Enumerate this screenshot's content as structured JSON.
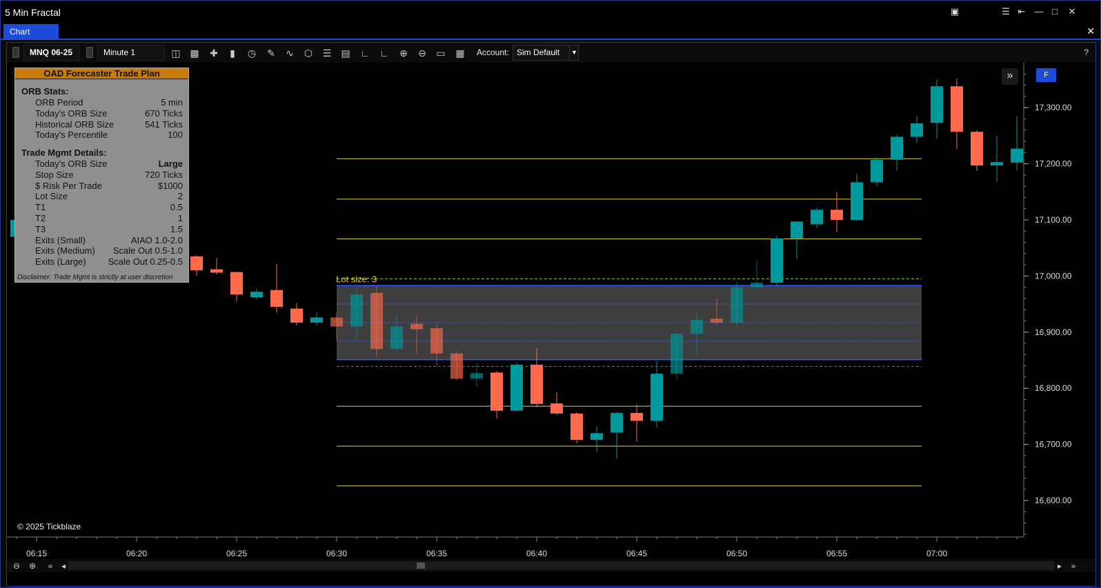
{
  "window": {
    "title": "5 Min Fractal"
  },
  "tabs": [
    {
      "label": "Chart",
      "active": true
    }
  ],
  "toolbar": {
    "instrument": "MNQ 06-25",
    "interval": "Minute 1",
    "account_label": "Account:",
    "account_value": "Sim Default",
    "help": "?",
    "tools": [
      "bar-type-icon",
      "chart-style-icon",
      "crosshair-icon",
      "candle-style-icon",
      "time-icon",
      "draw-icon",
      "indicator-icon",
      "object-icon",
      "list-icon",
      "data-box-icon",
      "axis-icon",
      "axis2-icon",
      "zoom-in-icon",
      "zoom-out-icon",
      "open-icon",
      "save-icon"
    ]
  },
  "panel": {
    "title": "OAD Forecaster Trade Plan",
    "orb_title": "ORB Stats:",
    "orb_rows": [
      {
        "k": "ORB Period",
        "v": "5 min"
      },
      {
        "k": "Today's ORB Size",
        "v": "670 Ticks"
      },
      {
        "k": "Historical ORB Size",
        "v": "541 Ticks"
      },
      {
        "k": "Today's Percentile",
        "v": "100"
      }
    ],
    "mgmt_title": "Trade Mgmt Details:",
    "mgmt_rows": [
      {
        "k": "Today's ORB Size",
        "v": "Large",
        "bold": true
      },
      {
        "k": "Stop Size",
        "v": "720 Ticks"
      },
      {
        "k": "$ Risk Per Trade",
        "v": "$1000"
      },
      {
        "k": "Lot Size",
        "v": "2"
      },
      {
        "k": "T1",
        "v": "0.5"
      },
      {
        "k": "T2",
        "v": "1"
      },
      {
        "k": "T3",
        "v": "1.5"
      },
      {
        "k": "Exits (Small)",
        "v": "AIAO 1.0-2.0"
      },
      {
        "k": "Exits (Medium)",
        "v": "Scale Out 0.5-1.0"
      },
      {
        "k": "Exits (Large)",
        "v": "Scale Out 0.25-0.5"
      }
    ],
    "disclaimer": "Disclaimer: Trade Mgmt is strictly at user discretion"
  },
  "copyright": "© 2025 Tickblaze",
  "f_button": "F",
  "chart_data": {
    "type": "candlestick",
    "price_axis_labels": [
      "17,300.00",
      "17,200.00",
      "17,100.00",
      "17,000.00",
      "16,900.00",
      "16,800.00",
      "16,700.00",
      "16,600.00"
    ],
    "price_axis_values": [
      17300,
      17200,
      17100,
      17000,
      16900,
      16800,
      16700,
      16600
    ],
    "time_axis_labels": [
      "06:15",
      "06:20",
      "06:25",
      "06:30",
      "06:35",
      "06:40",
      "06:45",
      "06:50",
      "06:55",
      "07:00"
    ],
    "ylim": [
      16535,
      17380
    ],
    "annotation": "Lot size: 3",
    "orb_high": 16983,
    "orb_low": 16851,
    "orb_mid_lines": [
      16950,
      16917,
      16884
    ],
    "entry_line": 16995,
    "stop_line": 16839,
    "target_lines_up": [
      17066,
      17137,
      17209
    ],
    "target_lines_down": [
      16768,
      16697,
      16626
    ],
    "colors": {
      "up": "#00999c",
      "down": "#ff6a4d",
      "target": "#e6d43a",
      "orb_fill": "#3e3e3e",
      "orb_edge": "#2a5cff"
    },
    "candles": [
      {
        "t": "06:14",
        "o": 17070,
        "h": 17090,
        "c": 17100,
        "l": 17060
      },
      {
        "t": "06:23",
        "o": 17035,
        "h": 17037,
        "c": 17010,
        "l": 17000
      },
      {
        "t": "06:24",
        "o": 17012,
        "h": 17032,
        "c": 17006,
        "l": 17003
      },
      {
        "t": "06:25",
        "o": 17007,
        "h": 17008,
        "c": 16967,
        "l": 16955
      },
      {
        "t": "06:26",
        "o": 16962,
        "h": 16977,
        "c": 16972,
        "l": 16958
      },
      {
        "t": "06:27",
        "o": 16975,
        "h": 17022,
        "c": 16945,
        "l": 16935
      },
      {
        "t": "06:28",
        "o": 16942,
        "h": 16952,
        "c": 16917,
        "l": 16912
      },
      {
        "t": "06:29",
        "o": 16917,
        "h": 16935,
        "c": 16926,
        "l": 16912
      },
      {
        "t": "06:30",
        "o": 16926,
        "h": 16935,
        "c": 16910,
        "l": 16885
      },
      {
        "t": "06:31",
        "o": 16910,
        "h": 16975,
        "c": 16967,
        "l": 16890
      },
      {
        "t": "06:32",
        "o": 16970,
        "h": 16982,
        "c": 16870,
        "l": 16855
      },
      {
        "t": "06:33",
        "o": 16870,
        "h": 16932,
        "c": 16910,
        "l": 16865
      },
      {
        "t": "06:34",
        "o": 16915,
        "h": 16930,
        "c": 16905,
        "l": 16862
      },
      {
        "t": "06:35",
        "o": 16907,
        "h": 16913,
        "c": 16862,
        "l": 16840
      },
      {
        "t": "06:36",
        "o": 16862,
        "h": 16866,
        "c": 16817,
        "l": 16814
      },
      {
        "t": "06:37",
        "o": 16817,
        "h": 16846,
        "c": 16827,
        "l": 16803
      },
      {
        "t": "06:38",
        "o": 16828,
        "h": 16831,
        "c": 16760,
        "l": 16746
      },
      {
        "t": "06:39",
        "o": 16760,
        "h": 16846,
        "c": 16842,
        "l": 16758
      },
      {
        "t": "06:40",
        "o": 16842,
        "h": 16872,
        "c": 16772,
        "l": 16766
      },
      {
        "t": "06:41",
        "o": 16773,
        "h": 16793,
        "c": 16755,
        "l": 16752
      },
      {
        "t": "06:42",
        "o": 16755,
        "h": 16757,
        "c": 16708,
        "l": 16702
      },
      {
        "t": "06:43",
        "o": 16708,
        "h": 16732,
        "c": 16720,
        "l": 16686
      },
      {
        "t": "06:44",
        "o": 16721,
        "h": 16758,
        "c": 16756,
        "l": 16674
      },
      {
        "t": "06:45",
        "o": 16756,
        "h": 16771,
        "c": 16742,
        "l": 16705
      },
      {
        "t": "06:46",
        "o": 16742,
        "h": 16848,
        "c": 16826,
        "l": 16730
      },
      {
        "t": "06:47",
        "o": 16826,
        "h": 16898,
        "c": 16897,
        "l": 16816
      },
      {
        "t": "06:48",
        "o": 16897,
        "h": 16935,
        "c": 16922,
        "l": 16855
      },
      {
        "t": "06:49",
        "o": 16924,
        "h": 16960,
        "c": 16917,
        "l": 16913
      },
      {
        "t": "06:50",
        "o": 16917,
        "h": 16990,
        "c": 16980,
        "l": 16910
      },
      {
        "t": "06:51",
        "o": 16980,
        "h": 17027,
        "c": 16988,
        "l": 16977
      },
      {
        "t": "06:52",
        "o": 16988,
        "h": 17072,
        "c": 17067,
        "l": 16983
      },
      {
        "t": "06:53",
        "o": 17067,
        "h": 17098,
        "c": 17097,
        "l": 17030
      },
      {
        "t": "06:54",
        "o": 17092,
        "h": 17122,
        "c": 17118,
        "l": 17085
      },
      {
        "t": "06:55",
        "o": 17118,
        "h": 17150,
        "c": 17100,
        "l": 17078
      },
      {
        "t": "06:56",
        "o": 17100,
        "h": 17182,
        "c": 17167,
        "l": 17098
      },
      {
        "t": "06:57",
        "o": 17167,
        "h": 17212,
        "c": 17207,
        "l": 17161
      },
      {
        "t": "06:58",
        "o": 17207,
        "h": 17252,
        "c": 17248,
        "l": 17188
      },
      {
        "t": "06:59",
        "o": 17248,
        "h": 17285,
        "c": 17272,
        "l": 17237
      },
      {
        "t": "07:00",
        "o": 17273,
        "h": 17350,
        "c": 17338,
        "l": 17245
      },
      {
        "t": "07:01",
        "o": 17338,
        "h": 17352,
        "c": 17257,
        "l": 17226
      },
      {
        "t": "07:02",
        "o": 17257,
        "h": 17260,
        "c": 17197,
        "l": 17187
      },
      {
        "t": "07:03",
        "o": 17197,
        "h": 17250,
        "c": 17203,
        "l": 17167
      },
      {
        "t": "07:04",
        "o": 17202,
        "h": 17285,
        "c": 17227,
        "l": 17188
      }
    ]
  }
}
